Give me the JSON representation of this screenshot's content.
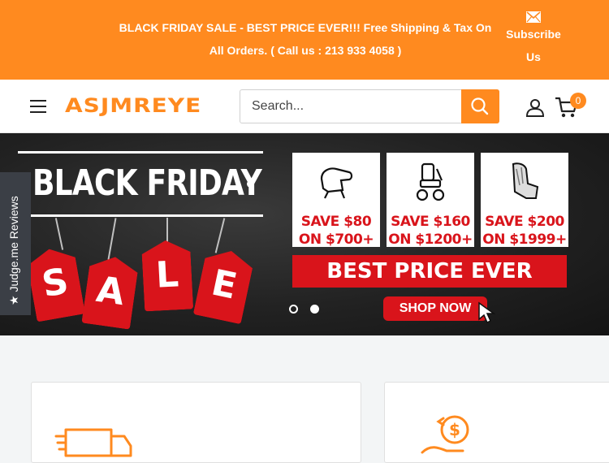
{
  "announcement": {
    "line1": "BLACK FRIDAY SALE -   BEST PRICE EVER!!! Free Shipping & Tax On",
    "line2": "All Orders. ( Call us : 213 933 4058 )",
    "subscribe_line1": "Subscribe",
    "subscribe_line2": "Us"
  },
  "header": {
    "logo": "ASJMREYE",
    "search_placeholder": "Search...",
    "cart_count": "0"
  },
  "banner": {
    "title": "BLACK FRIDAY",
    "tag_letters": [
      "S",
      "A",
      "L",
      "E"
    ],
    "promos": [
      {
        "line1": "SAVE $80",
        "line2": "ON $700+",
        "icon": "lift-chair-icon"
      },
      {
        "line1": "SAVE $160",
        "line2": "ON $1200+",
        "icon": "power-wheelchair-icon"
      },
      {
        "line1": "SAVE $200",
        "line2": "ON $1999+",
        "icon": "massage-chair-icon"
      }
    ],
    "best_price": "BEST PRICE EVER",
    "shop_now": "SHOP NOW",
    "slide_count": 2,
    "active_slide": 2
  },
  "reviews_tab": "★ Judge.me Reviews",
  "colors": {
    "brand_orange": "#ff8a1f",
    "banner_red": "#d9141b",
    "banner_dark": "#222222"
  }
}
